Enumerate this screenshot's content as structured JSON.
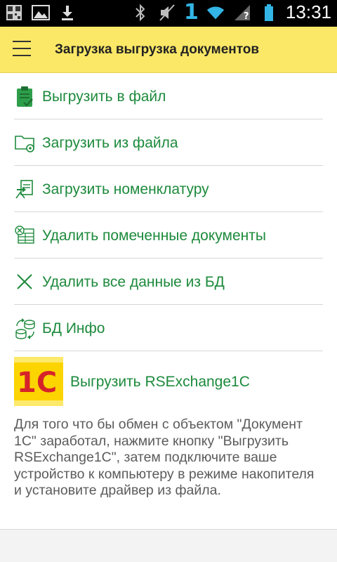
{
  "status_bar": {
    "signal_digit": "1",
    "time": "13:31"
  },
  "header": {
    "title": "Загрузка выгрузка документов"
  },
  "menu": {
    "items": [
      {
        "label": "Выгрузить в файл",
        "icon": "clipboard-check-icon"
      },
      {
        "label": "Загрузить из файла",
        "icon": "folder-gear-icon"
      },
      {
        "label": "Загрузить номенклатуру",
        "icon": "document-import-icon"
      },
      {
        "label": "Удалить помеченные документы",
        "icon": "table-delete-icon"
      },
      {
        "label": "Удалить все данные из БД",
        "icon": "close-icon"
      },
      {
        "label": "БД Инфо",
        "icon": "database-sync-icon"
      }
    ]
  },
  "export": {
    "logo_text": "1С",
    "label": "Выгрузить RSExchange1C"
  },
  "info_text": "Для того что бы обмен с объектом \"Документ 1С\" заработал, нажмите кнопку \"Выгрузить RSExchange1C\", затем подключите ваше устройство к компьютеру в режиме накопителя и установите драйвер из файла.",
  "colors": {
    "header_bg": "#fbe867",
    "accent_green": "#1d8a3c",
    "logo_red": "#d6232a",
    "logo_yellow": "#fcd400"
  }
}
